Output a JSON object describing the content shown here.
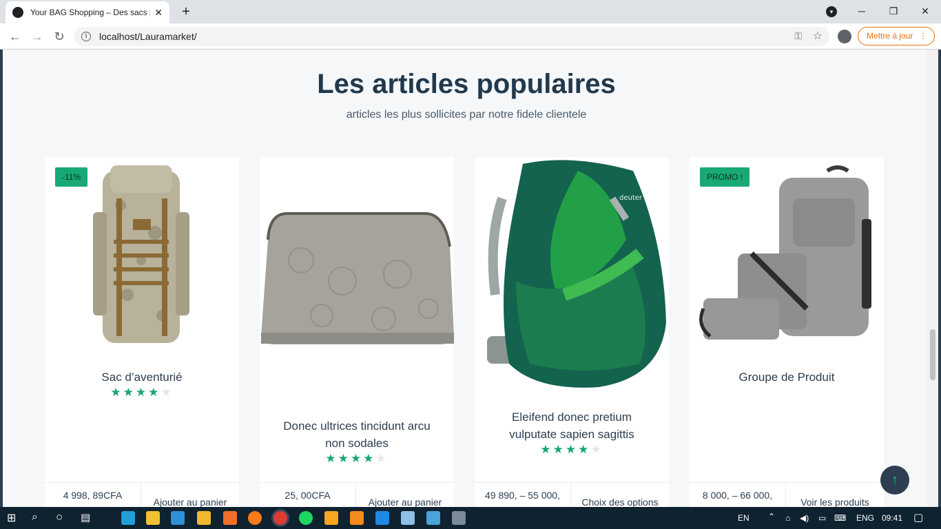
{
  "browser": {
    "tab_title": "Your BAG Shopping – Des sacs pour...",
    "url": "localhost/Lauramarket/",
    "update_button": "Mettre à jour"
  },
  "page": {
    "section_title": "Les articles populaires",
    "section_subtitle": "articles les plus sollicites par notre fidele clientele"
  },
  "products": [
    {
      "name": "Sac d’aventurié",
      "badge": "-11%",
      "rating": 4,
      "price": "4 998, 89CFA",
      "action": "Ajouter au panier"
    },
    {
      "name": "Donec ultrices tincidunt arcu non sodales",
      "badge": "",
      "rating": 4,
      "price": "25, 00CFA",
      "action": "Ajouter au panier"
    },
    {
      "name": "Eleifend donec pretium vulputate sapien sagittis",
      "badge": "",
      "rating": 4,
      "price": "49 890,  –  55 000,",
      "action": "Choix des options"
    },
    {
      "name": "Groupe de Produit",
      "badge": "PROMO !",
      "rating": 0,
      "price": "8 000,  –  66 000,",
      "action": "Voir les produits"
    }
  ],
  "taskbar": {
    "lang_short": "EN",
    "lang": "ENG",
    "time": "09:41"
  },
  "colors": {
    "accent": "#19a974",
    "title": "#22394d",
    "frame": "#2c3e50"
  }
}
